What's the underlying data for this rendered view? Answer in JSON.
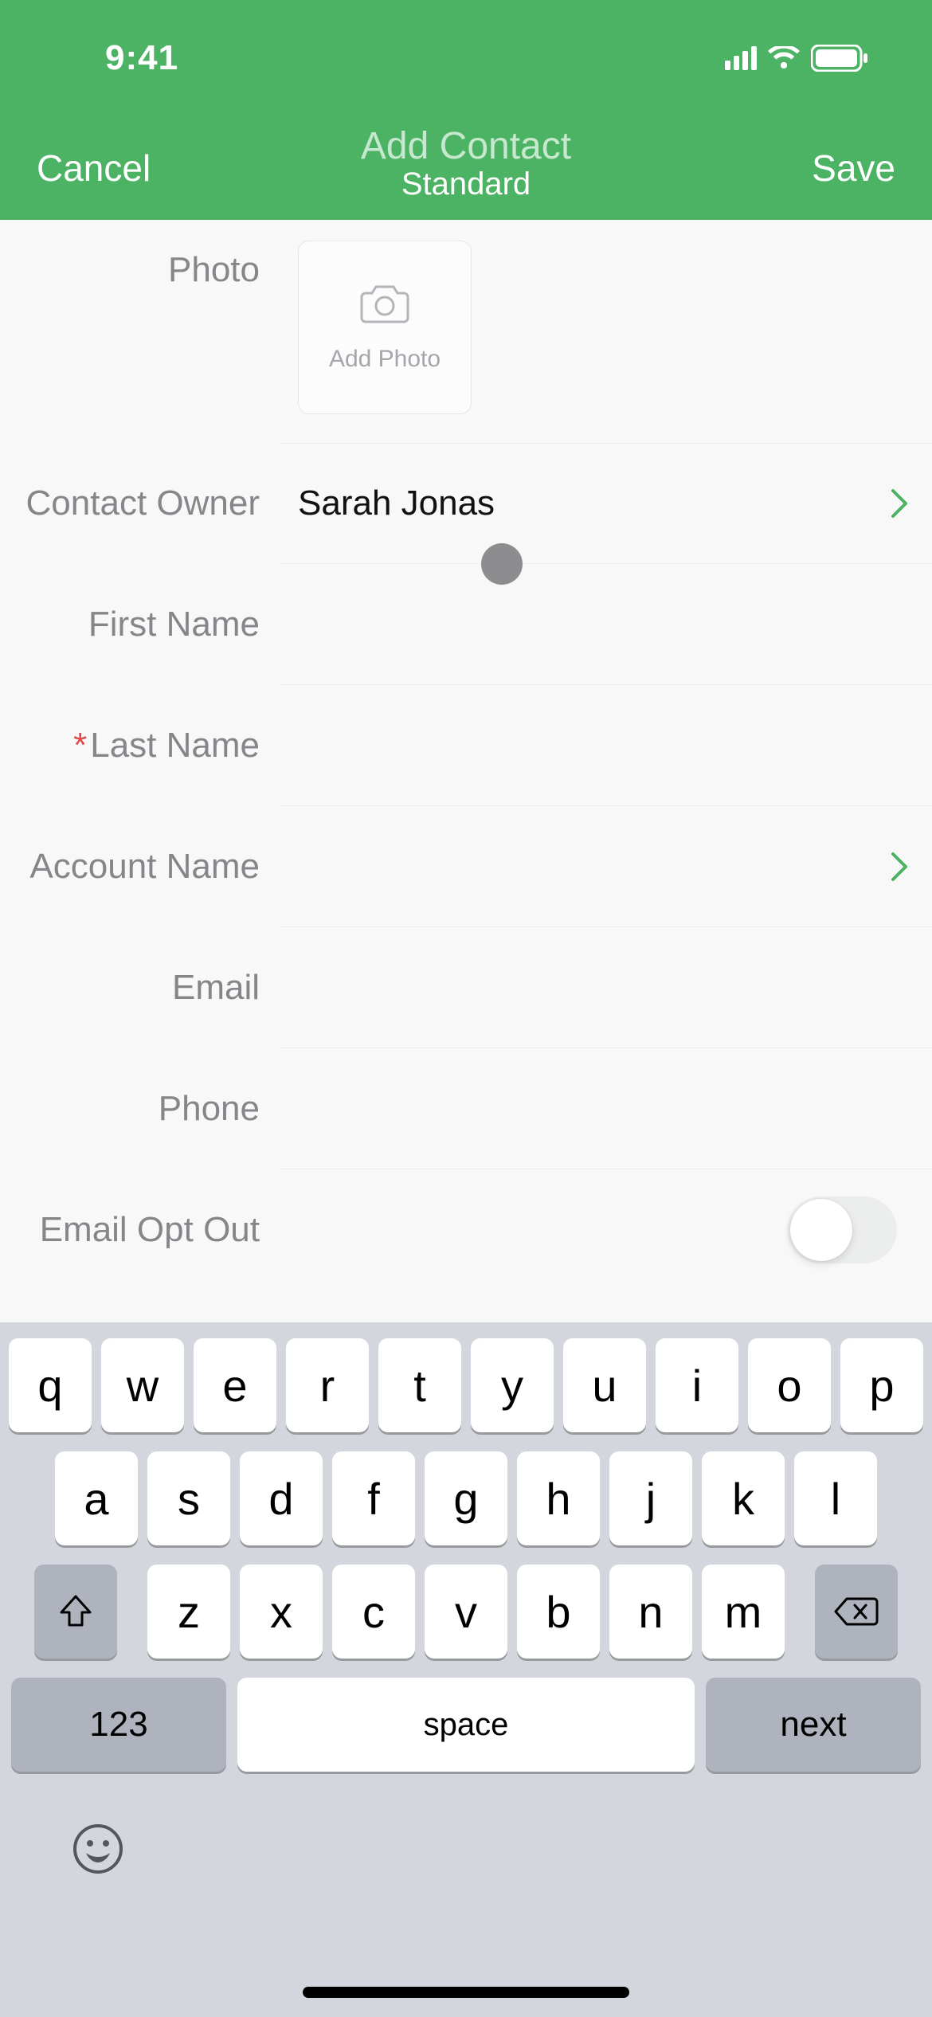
{
  "status": {
    "time": "9:41"
  },
  "nav": {
    "cancel": "Cancel",
    "title": "Add Contact",
    "subtitle": "Standard",
    "save": "Save"
  },
  "form": {
    "photo": {
      "label": "Photo",
      "button": "Add Photo"
    },
    "contact_owner": {
      "label": "Contact Owner",
      "value": "Sarah Jonas"
    },
    "first_name": {
      "label": "First Name",
      "value": ""
    },
    "last_name": {
      "label": "Last Name",
      "value": ""
    },
    "account_name": {
      "label": "Account Name",
      "value": ""
    },
    "email": {
      "label": "Email",
      "value": ""
    },
    "phone": {
      "label": "Phone",
      "value": ""
    },
    "email_opt_out": {
      "label": "Email Opt Out",
      "value": false
    }
  },
  "keyboard": {
    "row1": [
      "q",
      "w",
      "e",
      "r",
      "t",
      "y",
      "u",
      "i",
      "o",
      "p"
    ],
    "row2": [
      "a",
      "s",
      "d",
      "f",
      "g",
      "h",
      "j",
      "k",
      "l"
    ],
    "row3": [
      "z",
      "x",
      "c",
      "v",
      "b",
      "n",
      "m"
    ],
    "numbers": "123",
    "space": "space",
    "next": "next"
  }
}
